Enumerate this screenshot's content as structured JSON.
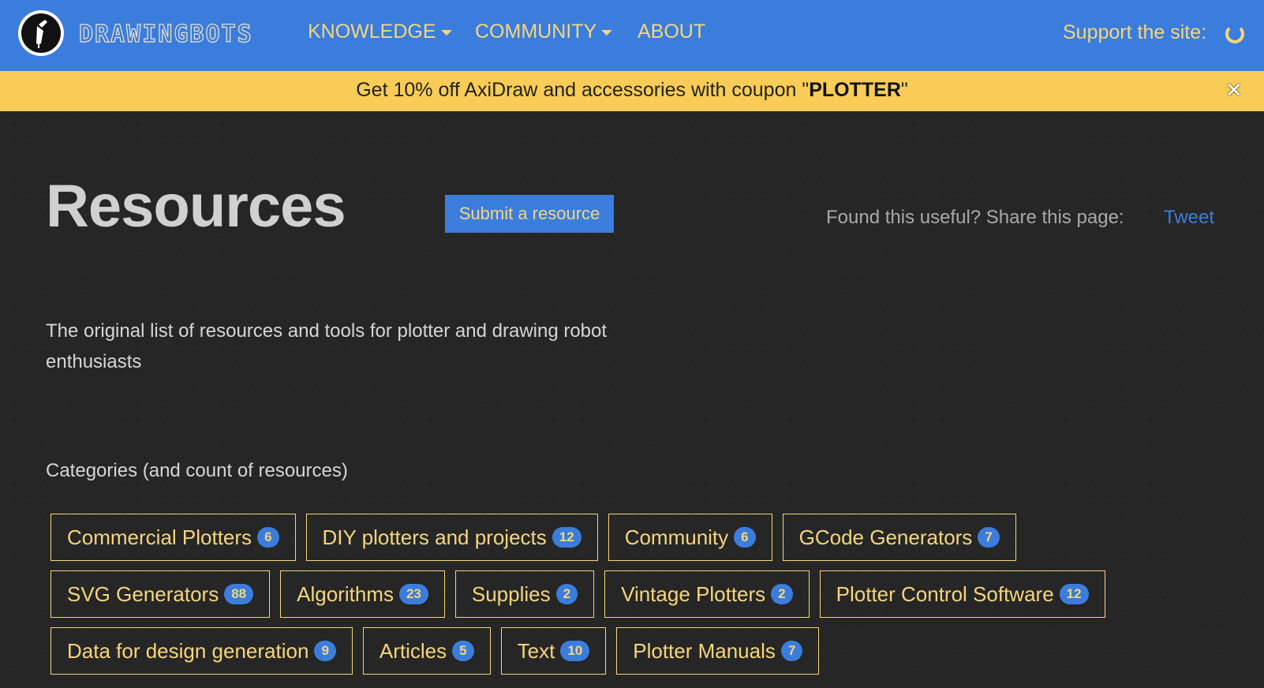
{
  "navbar": {
    "brand": "DRAWINGBOTS",
    "items": [
      {
        "label": "KNOWLEDGE",
        "dropdown": true
      },
      {
        "label": "COMMUNITY",
        "dropdown": true
      },
      {
        "label": "ABOUT",
        "dropdown": false
      }
    ],
    "support_label": "Support the site:",
    "support_icon": "coffee-cup-icon"
  },
  "banner": {
    "text_before": "Get 10% off AxiDraw and accessories with coupon \"",
    "coupon": "PLOTTER",
    "text_after": "\"",
    "close_icon": "close-icon"
  },
  "hero": {
    "title": "Resources",
    "submit_label": "Submit a resource",
    "share_text": "Found this useful? Share this page:",
    "tweet_label": "Tweet",
    "intro": "The original list of resources and tools for plotter and drawing robot enthusiasts"
  },
  "categories": {
    "heading": "Categories (and count of resources)",
    "rows": [
      [
        {
          "label": "Commercial Plotters",
          "count": "6"
        },
        {
          "label": "DIY plotters and projects",
          "count": "12"
        },
        {
          "label": "Community",
          "count": "6"
        },
        {
          "label": "GCode Generators",
          "count": "7"
        }
      ],
      [
        {
          "label": "SVG Generators",
          "count": "88"
        },
        {
          "label": "Algorithms",
          "count": "23"
        },
        {
          "label": "Supplies",
          "count": "2"
        },
        {
          "label": "Vintage Plotters",
          "count": "2"
        },
        {
          "label": "Plotter Control Software",
          "count": "12"
        }
      ],
      [
        {
          "label": "Data for design generation",
          "count": "9"
        },
        {
          "label": "Articles",
          "count": "5"
        },
        {
          "label": "Text",
          "count": "10"
        },
        {
          "label": "Plotter Manuals",
          "count": "7"
        }
      ]
    ]
  },
  "colors": {
    "navbar": "#3b7ddd",
    "banner": "#f9cc57",
    "accent_yellow": "#f6d67a",
    "background": "#262626"
  }
}
